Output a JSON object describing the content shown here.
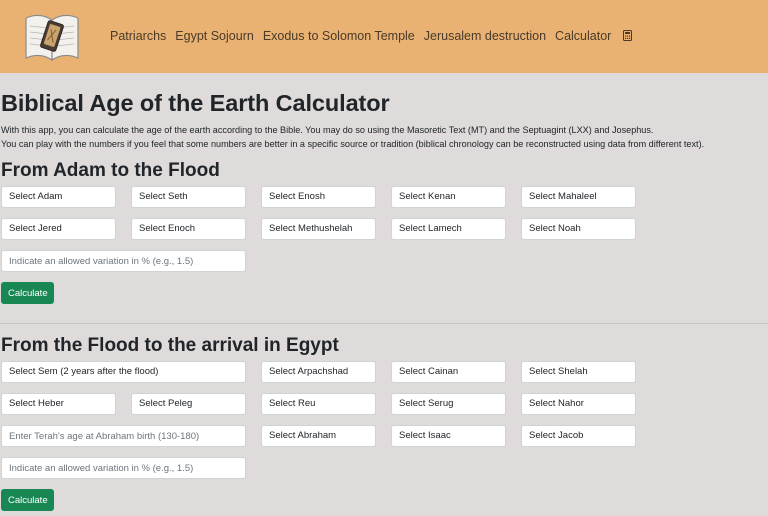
{
  "nav": {
    "links": [
      "Patriarchs",
      "Egypt Sojourn",
      "Exodus to Solomon Temple",
      "Jerusalem destruction",
      "Calculator"
    ]
  },
  "page": {
    "title": "Biblical Age of the Earth Calculator",
    "intro_line1": "With this app, you can calculate the age of the earth according to the Bible. You may do so using the Masoretic Text (MT) and the Septuagint (LXX) and Josephus.",
    "intro_line2": "You can play with the numbers if you feel that some numbers are better in a specific source or tradition (biblical chronology can be reconstructed using data from different text)."
  },
  "section1": {
    "title": "From Adam to the Flood",
    "selects": [
      "Select Adam",
      "Select Seth",
      "Select Enosh",
      "Select Kenan",
      "Select Mahaleel",
      "Select Jered",
      "Select Enoch",
      "Select Methushelah",
      "Select Lamech",
      "Select Noah"
    ],
    "variation_placeholder": "Indicate an allowed variation in % (e.g., 1.5)",
    "button": "Calculate"
  },
  "section2": {
    "title": "From the Flood to the arrival in Egypt",
    "selects": [
      "Select Sem (2 years after the flood)",
      "Select Arpachshad",
      "Select Cainan",
      "Select Shelah",
      "Select Heber",
      "Select Peleg",
      "Select Reu",
      "Select Serug",
      "Select Nahor",
      "Select Abraham",
      "Select Isaac",
      "Select Jacob"
    ],
    "terah_placeholder": "Enter Terah's age at Abraham birth (130-180)",
    "variation_placeholder": "Indicate an allowed variation in % (e.g., 1.5)",
    "button": "Calculate"
  },
  "colors": {
    "navbar": "#e9b272",
    "background": "#dedbda",
    "button": "#198754"
  },
  "icons": {
    "logo": "book-with-phone-logo",
    "calculator": "calculator-icon"
  }
}
